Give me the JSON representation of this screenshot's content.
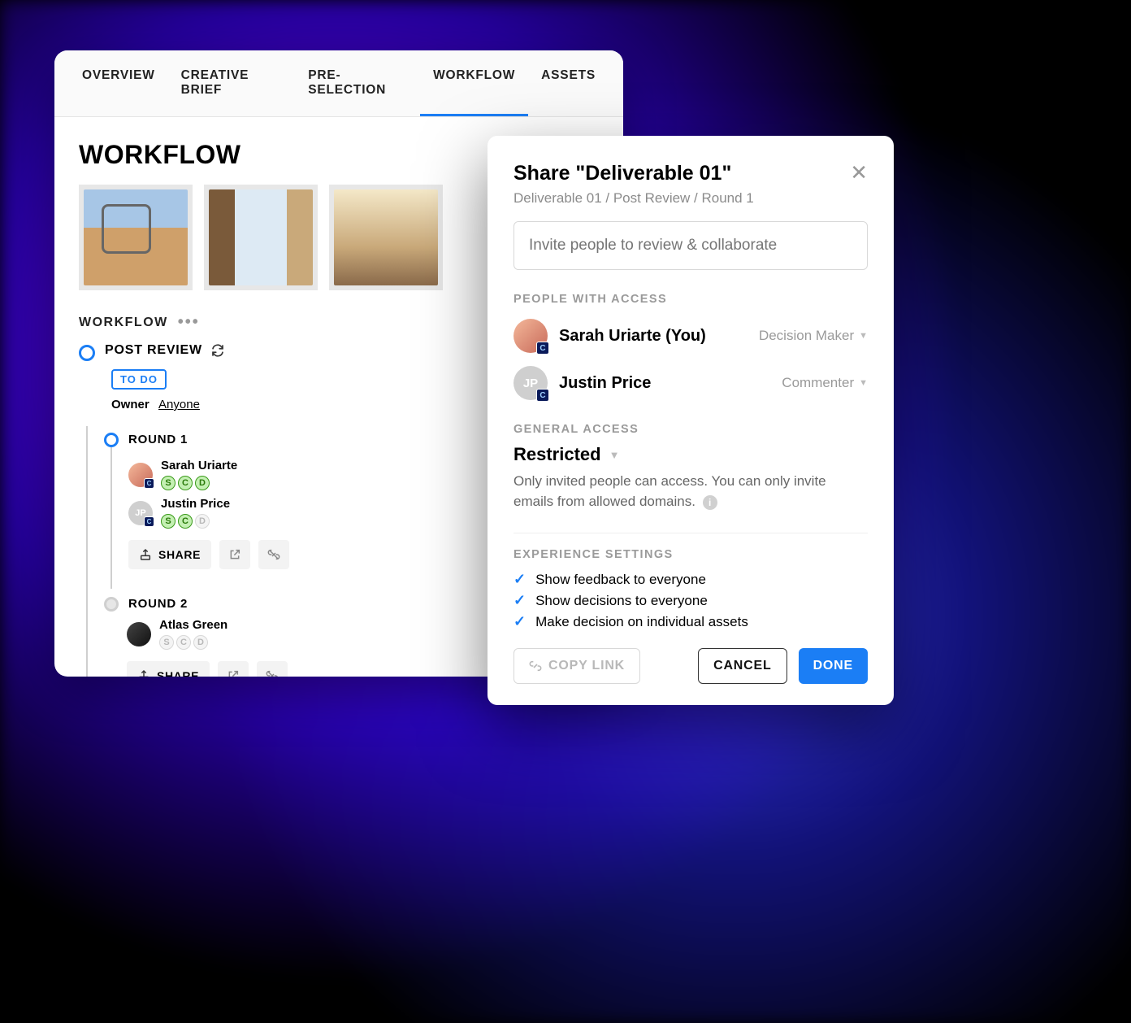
{
  "tabs": {
    "overview": "OVERVIEW",
    "creative_brief": "CREATIVE BRIEF",
    "pre_selection": "PRE-SELECTION",
    "workflow": "WORKFLOW",
    "assets": "ASSETS",
    "active": "workflow"
  },
  "page": {
    "title": "WORKFLOW"
  },
  "workflow": {
    "section_label": "WORKFLOW",
    "post_review": {
      "title": "POST REVIEW",
      "status_chip": "TO DO",
      "owner_label": "Owner",
      "owner_value": "Anyone"
    },
    "rounds": [
      {
        "title": "ROUND 1",
        "status": "active",
        "people": [
          {
            "name": "Sarah Uriarte",
            "avatar_initials": "",
            "avatar_style": "sarah",
            "roles": {
              "S": true,
              "C": true,
              "D": true
            }
          },
          {
            "name": "Justin Price",
            "avatar_initials": "JP",
            "avatar_style": "grey",
            "roles": {
              "S": true,
              "C": true,
              "D": false
            }
          }
        ],
        "share_label": "SHARE"
      },
      {
        "title": "ROUND 2",
        "status": "pending",
        "people": [
          {
            "name": "Atlas Green",
            "avatar_initials": "",
            "avatar_style": "atlas",
            "roles": {
              "S": false,
              "C": false,
              "D": false
            }
          }
        ],
        "share_label": "SHARE"
      }
    ]
  },
  "share_modal": {
    "title": "Share \"Deliverable 01\"",
    "breadcrumb": "Deliverable 01 / Post Review / Round 1",
    "invite_placeholder": "Invite people to review & collaborate",
    "people_label": "PEOPLE WITH ACCESS",
    "people": [
      {
        "name": "Sarah Uriarte (You)",
        "role": "Decision Maker",
        "avatar_initials": "",
        "avatar_style": "sarah"
      },
      {
        "name": "Justin Price",
        "role": "Commenter",
        "avatar_initials": "JP",
        "avatar_style": "grey"
      }
    ],
    "general_access": {
      "label": "GENERAL ACCESS",
      "level": "Restricted",
      "description": "Only invited people can access. You can only invite emails from allowed domains."
    },
    "experience": {
      "label": "EXPERIENCE SETTINGS",
      "items": [
        "Show feedback to everyone",
        "Show decisions to everyone",
        "Make decision on individual assets"
      ]
    },
    "buttons": {
      "copy_link": "COPY LINK",
      "cancel": "CANCEL",
      "done": "DONE"
    }
  }
}
